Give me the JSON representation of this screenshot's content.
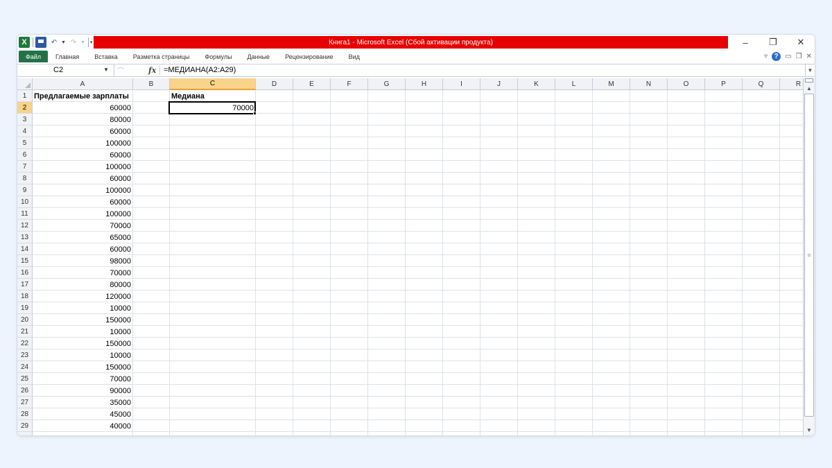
{
  "window": {
    "title": "Книга1  -  Microsoft Excel (Сбой активации продукта)",
    "title_bar_color": "#e60000",
    "controls": [
      "–",
      "❐",
      "✕"
    ]
  },
  "quick_access": {
    "app_icon": "X",
    "items": [
      "save-icon",
      "undo-icon",
      "redo-icon",
      "customize-icon"
    ]
  },
  "ribbon": {
    "file_tab": "Файл",
    "file_tab_color": "#217346",
    "tabs": [
      "Главная",
      "Вставка",
      "Разметка страницы",
      "Формулы",
      "Данные",
      "Рецензирование",
      "Вид"
    ]
  },
  "formula_bar": {
    "name_box": "C2",
    "fx_label": "fx",
    "formula": "=МЕДИАНА(A2:A29)"
  },
  "grid": {
    "columns": [
      "A",
      "B",
      "C",
      "D",
      "E",
      "F",
      "G",
      "H",
      "I",
      "J",
      "K",
      "L",
      "M",
      "N",
      "O",
      "P",
      "Q",
      "R"
    ],
    "selected_column": "C",
    "selected_row": 2,
    "active_cell": "C2",
    "rows": [
      1,
      2,
      3,
      4,
      5,
      6,
      7,
      8,
      9,
      10,
      11,
      12,
      13,
      14,
      15,
      16,
      17,
      18,
      19,
      20,
      21,
      22,
      23,
      24,
      25,
      26,
      27,
      28,
      29
    ],
    "header_a1": "Предлагаемые зарплаты",
    "header_c1": "Медиана",
    "median_c2": "70000",
    "salaries": [
      "60000",
      "80000",
      "60000",
      "100000",
      "60000",
      "100000",
      "60000",
      "100000",
      "60000",
      "100000",
      "70000",
      "65000",
      "60000",
      "98000",
      "70000",
      "80000",
      "120000",
      "10000",
      "150000",
      "10000",
      "150000",
      "10000",
      "150000",
      "70000",
      "90000",
      "35000",
      "45000",
      "40000"
    ]
  }
}
